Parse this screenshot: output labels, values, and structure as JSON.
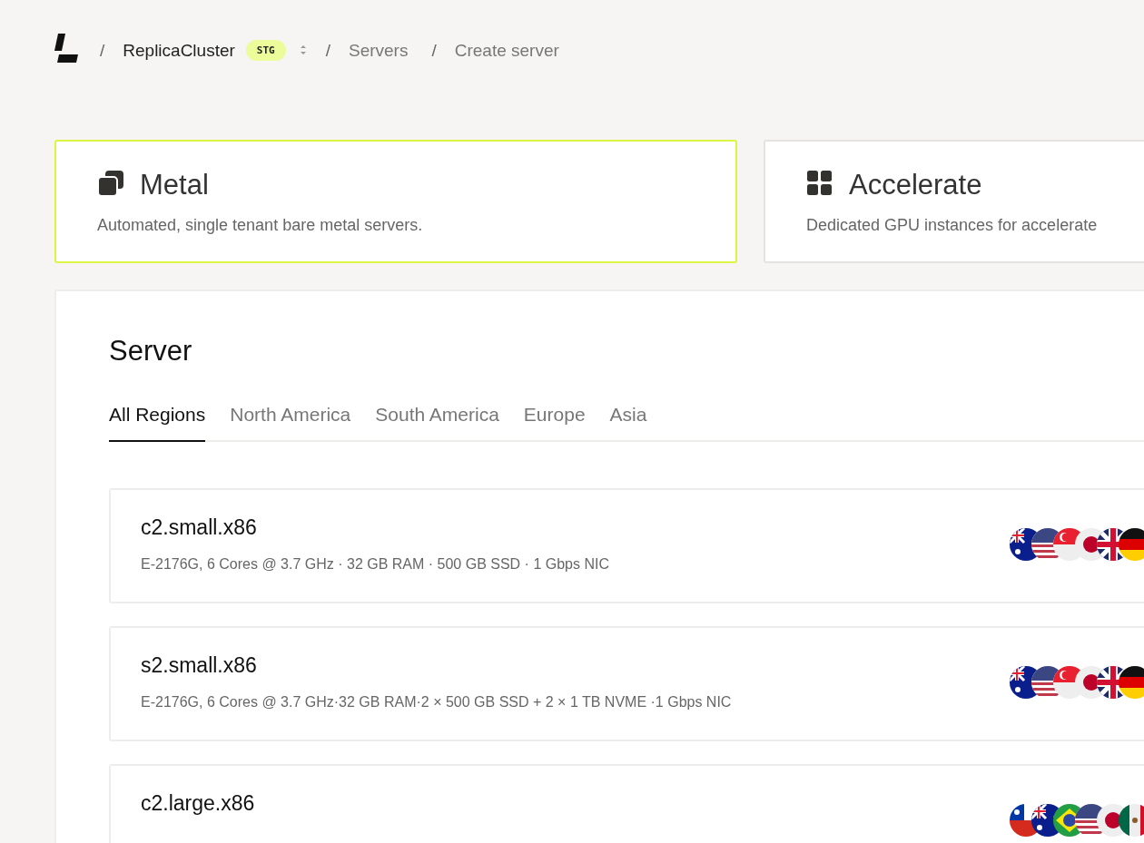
{
  "breadcrumb": [
    {
      "separator": "/",
      "label": "ReplicaCluster",
      "badge": "STG",
      "switcher": true
    },
    {
      "separator": "/",
      "label": "Servers"
    },
    {
      "separator": "/",
      "label": "Create server"
    }
  ],
  "products": [
    {
      "kind": "stack",
      "title": "Metal",
      "description": "Automated, single tenant bare metal servers.",
      "selected": true
    },
    {
      "kind": "grid",
      "title": "Accelerate",
      "description": "Dedicated GPU instances for accelerate",
      "selected": false
    }
  ],
  "server": {
    "title": "Server",
    "tabs": [
      {
        "label": "All Regions",
        "selected": true
      },
      {
        "label": "North America",
        "selected": false
      },
      {
        "label": "South America",
        "selected": false
      },
      {
        "label": "Europe",
        "selected": false
      },
      {
        "label": "Asia",
        "selected": false
      }
    ],
    "plans": [
      {
        "name": "c2.small.x86",
        "specs": "E-2176G, 6 Cores @ 3.7 GHz · 32 GB RAM · 500 GB SSD · 1 Gbps NIC",
        "flags": [
          {
            "kind": "au"
          },
          {
            "kind": "us"
          },
          {
            "kind": "sg"
          },
          {
            "kind": "jp"
          },
          {
            "kind": "gb"
          },
          {
            "kind": "de"
          }
        ]
      },
      {
        "name": "s2.small.x86",
        "specs": "E-2176G, 6 Cores @ 3.7 GHz·32 GB RAM·2 × 500 GB SSD + 2 × 1 TB NVME ·1 Gbps NIC",
        "flags": [
          {
            "kind": "au"
          },
          {
            "kind": "us"
          },
          {
            "kind": "sg"
          },
          {
            "kind": "jp"
          },
          {
            "kind": "gb"
          },
          {
            "kind": "de"
          }
        ]
      },
      {
        "name": "c2.large.x86",
        "flags": [
          {
            "kind": "cl"
          },
          {
            "kind": "au"
          },
          {
            "kind": "br"
          },
          {
            "kind": "us"
          },
          {
            "kind": "jp"
          },
          {
            "kind": "mx"
          }
        ]
      }
    ]
  }
}
